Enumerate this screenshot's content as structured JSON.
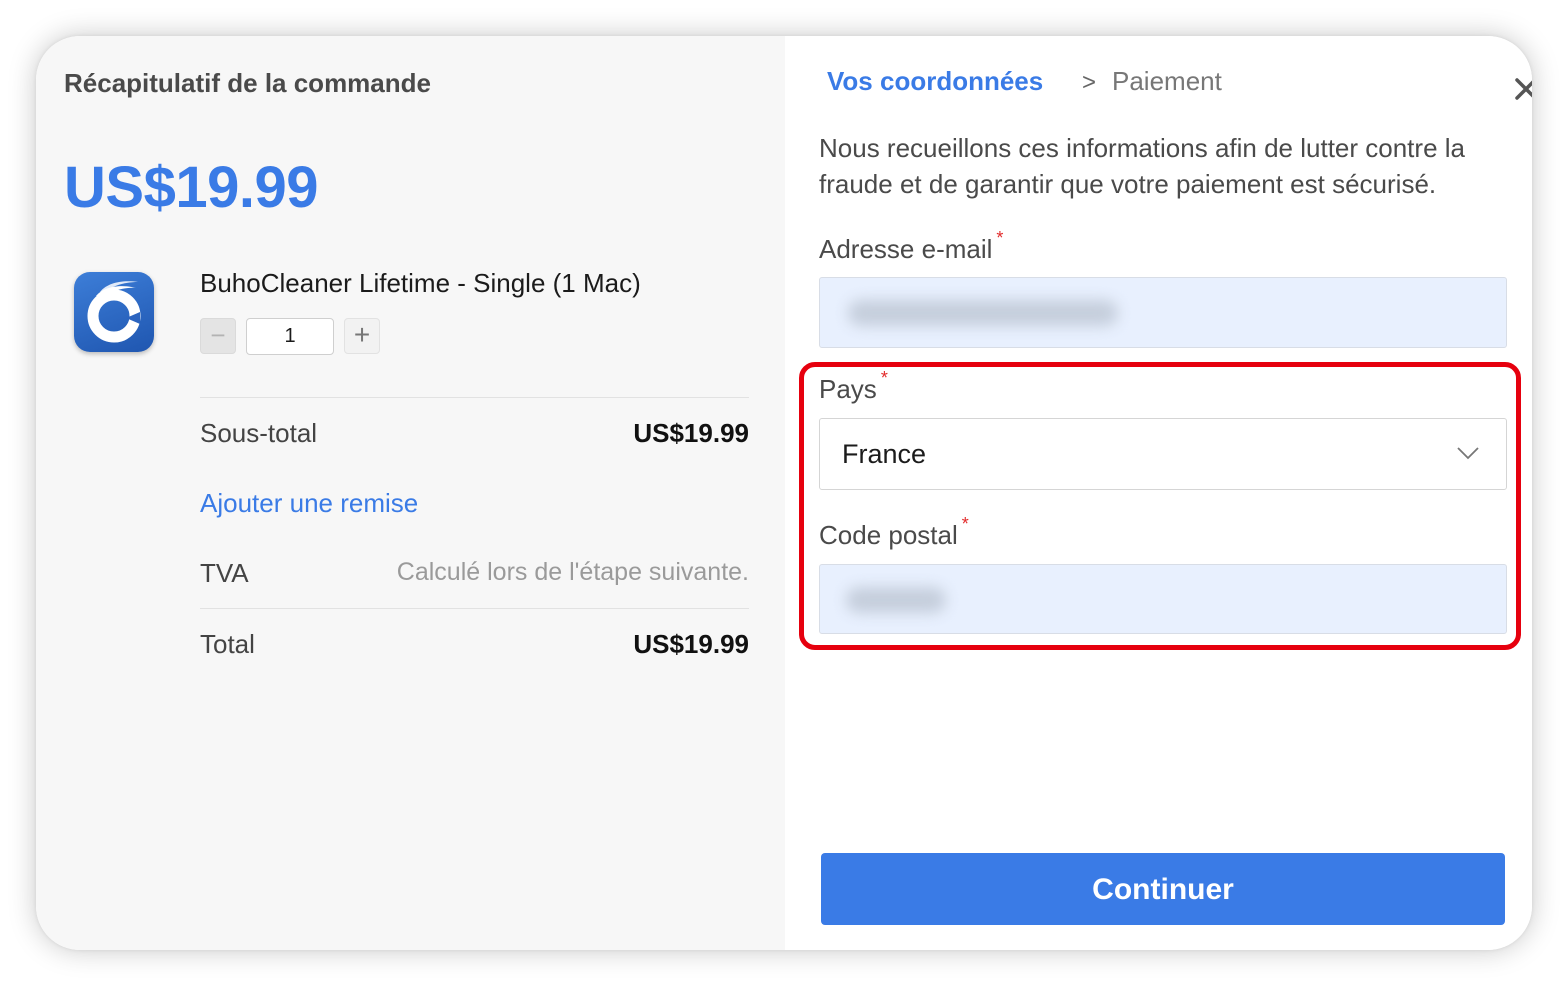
{
  "summary": {
    "title": "Récapitulatif de la commande",
    "big_price": "US$19.99",
    "product": {
      "icon": "buhocleaner-app-icon",
      "name": "BuhoCleaner Lifetime - Single (1 Mac)",
      "quantity": "1",
      "minus_symbol": "−",
      "plus_symbol": "+"
    },
    "subtotal_label": "Sous-total",
    "subtotal_value": "US$19.99",
    "discount_link": "Ajouter une remise",
    "vat_label": "TVA",
    "vat_note": "Calculé lors de l'étape suivante.",
    "total_label": "Total",
    "total_value": "US$19.99"
  },
  "checkout": {
    "breadcrumb": {
      "step1": "Vos coordonnées",
      "separator": ">",
      "step2": "Paiement"
    },
    "close_icon": "close-icon",
    "info_text": "Nous recueillons ces informations afin de lutter contre la fraude et de garantir que votre paiement est sécurisé.",
    "required_marker": "*",
    "email_label": "Adresse e-mail",
    "email_value": "",
    "country_label": "Pays",
    "country_value": "France",
    "postal_label": "Code postal",
    "postal_value": "",
    "continue_label": "Continuer"
  },
  "colors": {
    "accent": "#3a7be6",
    "highlight": "#e6000e",
    "left_panel_bg": "#f7f7f7",
    "autofill_bg": "#e8f0fe"
  }
}
